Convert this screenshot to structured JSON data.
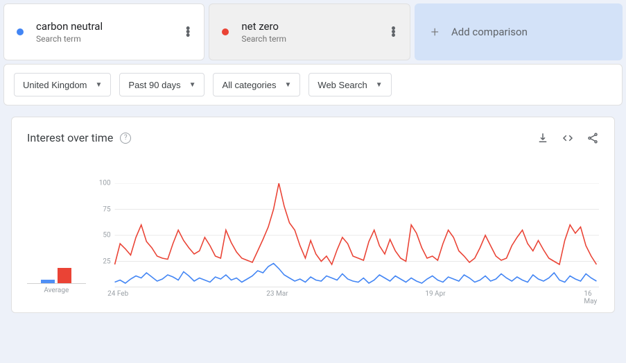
{
  "terms": [
    {
      "label": "carbon neutral",
      "sub": "Search term",
      "color": "#4285f4"
    },
    {
      "label": "net zero",
      "sub": "Search term",
      "color": "#ea4335"
    }
  ],
  "add_comparison": {
    "label": "Add comparison"
  },
  "filters": {
    "region": "United Kingdom",
    "range": "Past 90 days",
    "category": "All categories",
    "type": "Web Search"
  },
  "chart": {
    "title": "Interest over time",
    "avg_label": "Average"
  },
  "chart_data": {
    "type": "line",
    "title": "Interest over time",
    "ylabel": "",
    "xlabel": "",
    "ylim": [
      0,
      100
    ],
    "y_ticks": [
      25,
      50,
      75,
      100
    ],
    "x_tick_labels": [
      "24 Feb",
      "23 Mar",
      "19 Apr",
      "16 May"
    ],
    "x_tick_positions": [
      0,
      30,
      60,
      90
    ],
    "series": [
      {
        "name": "carbon neutral",
        "color": "#4285f4",
        "average": 8,
        "values": [
          5,
          7,
          4,
          8,
          11,
          9,
          14,
          10,
          6,
          8,
          12,
          10,
          7,
          15,
          11,
          6,
          9,
          7,
          5,
          10,
          8,
          12,
          7,
          9,
          5,
          8,
          11,
          16,
          14,
          20,
          23,
          18,
          12,
          9,
          6,
          8,
          5,
          10,
          7,
          6,
          11,
          9,
          7,
          13,
          8,
          6,
          5,
          9,
          4,
          7,
          12,
          9,
          6,
          11,
          8,
          5,
          9,
          6,
          4,
          8,
          11,
          7,
          5,
          10,
          8,
          6,
          12,
          9,
          5,
          7,
          11,
          6,
          8,
          13,
          9,
          6,
          10,
          7,
          5,
          12,
          8,
          6,
          9,
          14,
          7,
          5,
          11,
          8,
          6,
          13,
          9,
          6
        ]
      },
      {
        "name": "net zero",
        "color": "#ea4335",
        "average": 38,
        "values": [
          22,
          42,
          37,
          31,
          48,
          60,
          44,
          38,
          30,
          28,
          27,
          42,
          55,
          45,
          38,
          32,
          35,
          48,
          40,
          30,
          28,
          55,
          43,
          34,
          28,
          26,
          24,
          35,
          46,
          58,
          75,
          100,
          78,
          62,
          55,
          40,
          28,
          45,
          32,
          25,
          30,
          22,
          36,
          48,
          42,
          30,
          28,
          26,
          44,
          55,
          40,
          32,
          46,
          35,
          28,
          25,
          60,
          52,
          38,
          28,
          30,
          26,
          42,
          55,
          48,
          35,
          30,
          24,
          28,
          38,
          50,
          40,
          30,
          26,
          28,
          40,
          48,
          55,
          42,
          35,
          45,
          36,
          28,
          25,
          22,
          45,
          60,
          52,
          58,
          40,
          30,
          22
        ]
      }
    ]
  }
}
